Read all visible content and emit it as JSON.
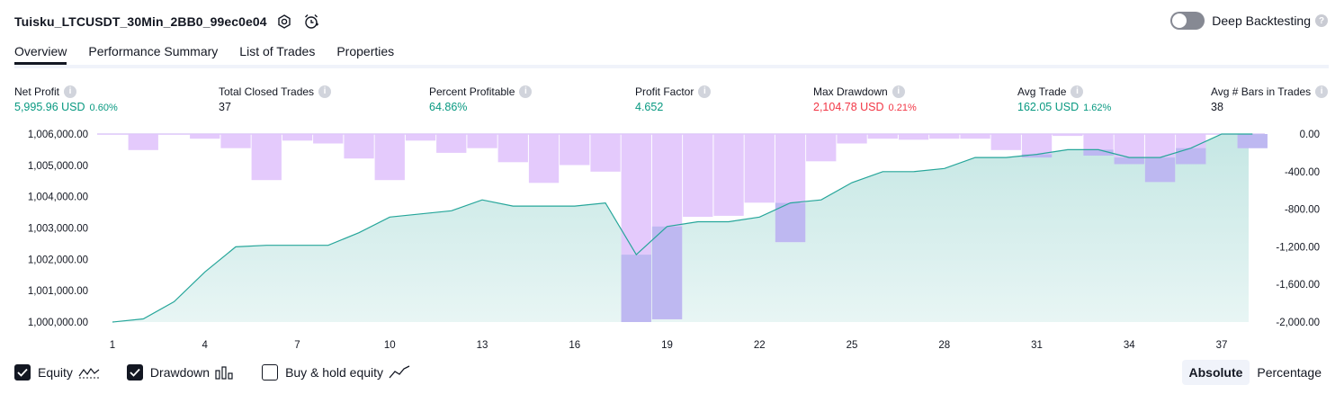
{
  "header": {
    "strategy_name": "Tuisku_LTCUSDT_30Min_2BB0_99ec0e04",
    "deep_backtesting_label": "Deep Backtesting"
  },
  "tabs": [
    {
      "label": "Overview",
      "active": true
    },
    {
      "label": "Performance Summary",
      "active": false
    },
    {
      "label": "List of Trades",
      "active": false
    },
    {
      "label": "Properties",
      "active": false
    }
  ],
  "metrics": {
    "net_profit": {
      "label": "Net Profit",
      "value": "5,995.96 USD",
      "pct": "0.60%"
    },
    "total_closed_trades": {
      "label": "Total Closed Trades",
      "value": "37"
    },
    "percent_profitable": {
      "label": "Percent Profitable",
      "value": "64.86%"
    },
    "profit_factor": {
      "label": "Profit Factor",
      "value": "4.652"
    },
    "max_drawdown": {
      "label": "Max Drawdown",
      "value": "2,104.78 USD",
      "pct": "0.21%"
    },
    "avg_trade": {
      "label": "Avg Trade",
      "value": "162.05 USD",
      "pct": "1.62%"
    },
    "avg_bars": {
      "label": "Avg # Bars in Trades",
      "value": "38"
    }
  },
  "legend": {
    "equity_label": "Equity",
    "drawdown_label": "Drawdown",
    "buy_hold_label": "Buy & hold equity",
    "equity_checked": true,
    "drawdown_checked": true,
    "buy_hold_checked": false
  },
  "mode": {
    "absolute_label": "Absolute",
    "percentage_label": "Percentage",
    "selected": "Absolute"
  },
  "colors": {
    "equity_line": "#26a69a",
    "equity_fill": "#b2dfdb",
    "drawdown_bar": "#e1c4fc",
    "drawdown_overlap": "#b7b5ef",
    "positive": "#089981",
    "negative": "#f23645"
  },
  "chart_data": {
    "type": "line",
    "x": [
      1,
      2,
      3,
      4,
      5,
      6,
      7,
      8,
      9,
      10,
      11,
      12,
      13,
      14,
      15,
      16,
      17,
      18,
      19,
      20,
      21,
      22,
      23,
      24,
      25,
      26,
      27,
      28,
      29,
      30,
      31,
      32,
      33,
      34,
      35,
      36,
      37,
      38
    ],
    "x_ticks": [
      "1",
      "4",
      "7",
      "10",
      "13",
      "16",
      "19",
      "22",
      "25",
      "28",
      "31",
      "34",
      "37"
    ],
    "series": [
      {
        "name": "Equity",
        "type": "area",
        "axis": "left",
        "values": [
          1000000,
          1000100,
          1000650,
          1001600,
          1002400,
          1002450,
          1002450,
          1002450,
          1002850,
          1003350,
          1003450,
          1003550,
          1003900,
          1003700,
          1003700,
          1003700,
          1003800,
          1002150,
          1003050,
          1003200,
          1003200,
          1003350,
          1003800,
          1003900,
          1004450,
          1004800,
          1004800,
          1004900,
          1005250,
          1005250,
          1005350,
          1005500,
          1005500,
          1005250,
          1005250,
          1005550,
          1006000,
          1006000
        ]
      },
      {
        "name": "Drawdown",
        "type": "bar",
        "axis": "right",
        "values": [
          0,
          -170,
          0,
          -50,
          -150,
          -490,
          -70,
          -100,
          -260,
          -490,
          -70,
          -200,
          -150,
          -300,
          -520,
          -330,
          -400,
          -2000,
          -1970,
          -880,
          -870,
          -730,
          -1150,
          -290,
          -100,
          -50,
          -60,
          -50,
          -50,
          -170,
          -250,
          -20,
          -230,
          -320,
          -510,
          -320,
          0,
          -150
        ]
      }
    ],
    "y_left": {
      "ticks": [
        "1,000,000.00",
        "1,001,000.00",
        "1,002,000.00",
        "1,003,000.00",
        "1,004,000.00",
        "1,005,000.00",
        "1,006,000.00"
      ],
      "lim": [
        1000000,
        1006000
      ]
    },
    "y_right": {
      "ticks": [
        "0.00",
        "-400.00",
        "-800.00",
        "-1,200.00",
        "-1,600.00",
        "-2,000.00"
      ],
      "lim": [
        -2000,
        0
      ]
    }
  }
}
